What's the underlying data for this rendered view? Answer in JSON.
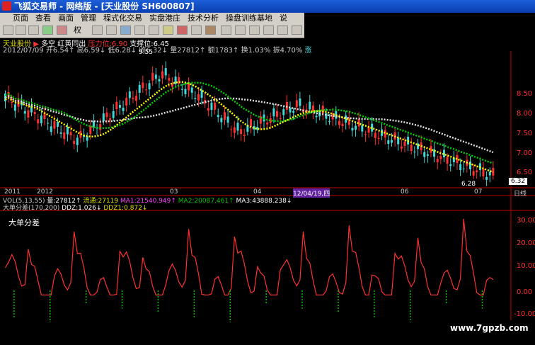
{
  "window": {
    "title": "飞狐交易师 - 网络版 - [天业股份 SH600807]"
  },
  "menu": [
    "页面",
    "查看",
    "画面",
    "管理",
    "程式化交易",
    "实盘港庄",
    "技术分析",
    "操盘训练基地",
    "说"
  ],
  "toolbar": {
    "rights_label": "权"
  },
  "stock": {
    "name": "天业股份",
    "trend": "多空",
    "signal": "红黄同出",
    "pressure": "压力位:6.90",
    "support": "支撑位:6.45",
    "date": "2012/07/09",
    "open": "开6.54↑",
    "high": "高6.59↓",
    "low": "低6.28↓",
    "close": "收6.32↓",
    "volume": "量27812↑",
    "amount": "额1783↑",
    "turnover": "换1.03%",
    "amplitude": "振4.70%",
    "flag": "涨"
  },
  "main_chart": {
    "price_ticks": [
      "8.50",
      "8.00",
      "7.50",
      "7.00",
      "6.50"
    ],
    "price_current": "6.32",
    "high_marker": "9.55",
    "low_marker": "6.28",
    "date_labels": [
      "2011",
      "2012",
      "03",
      "04",
      "12/04/19,四",
      "06",
      "07"
    ],
    "date_tag": "日线"
  },
  "vol_line": {
    "label": "VOL(5,13,55)",
    "vol": "量:27812↑",
    "circ": "流通:27119",
    "ma1": "MA1:21540.949↑",
    "ma2": "MA2:20087.461↑",
    "ma3": "MA3:43888.238↓"
  },
  "ddz_line": {
    "label": "大单分差(170,200)",
    "ddz": "DDZ:1.026↓",
    "ddz1": "DDZ1:0.872↓"
  },
  "sub_chart": {
    "title": "大单分差",
    "ticks": [
      "30.00",
      "20.00",
      "10.00",
      "0.00",
      "-10.00"
    ]
  },
  "watermark": "www.7gpzb.com",
  "colors": {
    "up": "#ff3030",
    "down": "#00c000",
    "ma_white": "#e0e0e0",
    "ma_green": "#00d000",
    "ma_yellow": "#ffff00"
  }
}
